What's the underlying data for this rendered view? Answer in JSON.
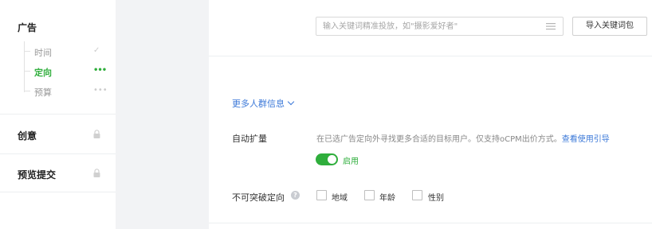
{
  "sidebar": {
    "section_ad": "广告",
    "items": [
      {
        "label": "时间",
        "status": "✓"
      },
      {
        "label": "定向",
        "status": "•••"
      },
      {
        "label": "预算",
        "status": "•••"
      }
    ],
    "section_creative": "创意",
    "section_preview": "预览提交"
  },
  "keyword": {
    "placeholder": "输入关键词精准投放，如\"摄影爱好者\"",
    "import_label": "导入关键词包"
  },
  "more_link": "更多人群信息",
  "auto_expand": {
    "label": "自动扩量",
    "hint": "在已选广告定向外寻找更多合适的目标用户。仅支持oCPM出价方式。",
    "guide_link": "查看使用引导",
    "toggle_label": "启用",
    "enabled": true
  },
  "no_breakthrough": {
    "label": "不可突破定向",
    "options": [
      "地域",
      "年龄",
      "性别"
    ]
  },
  "colors": {
    "accent_green": "#2fae3c",
    "link_blue": "#3b78d8"
  }
}
